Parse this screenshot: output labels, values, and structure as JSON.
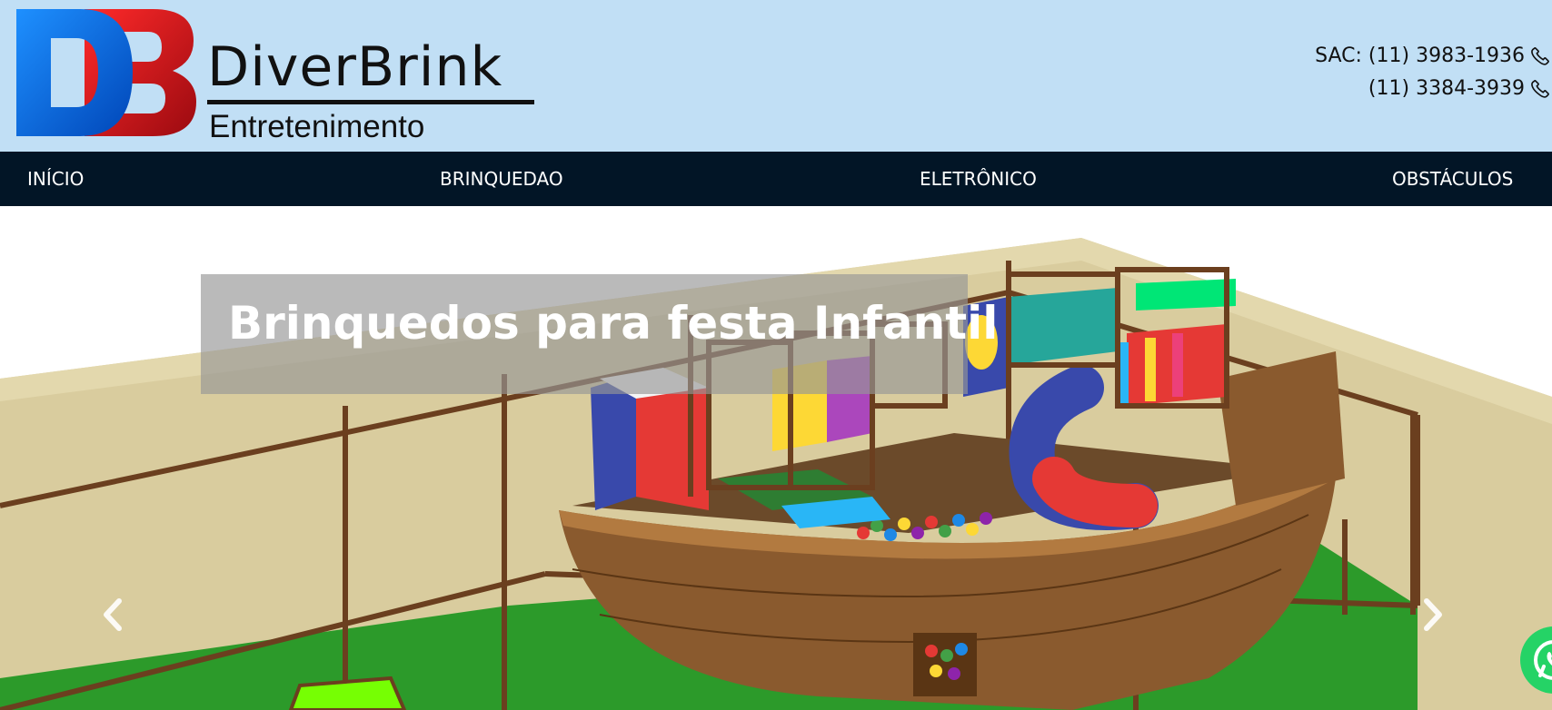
{
  "header": {
    "brand_name": "DiverBrink",
    "brand_sub": "Entretenimento",
    "logo_letters": "DB",
    "contacts": [
      {
        "label": "SAC: (11) 3983-1936",
        "icon": "phone-icon"
      },
      {
        "label": "(11) 3384-3939",
        "icon": "phone-icon"
      }
    ]
  },
  "nav": {
    "items": [
      "INÍCIO",
      "BRINQUEDAO",
      "ELETRÔNICO",
      "OBSTÁCULOS"
    ]
  },
  "hero": {
    "caption": "Brinquedos para festa Infantil",
    "prev_icon": "chevron-left-icon",
    "next_icon": "chevron-right-icon"
  },
  "floating": {
    "whatsapp_icon": "whatsapp-icon"
  },
  "colors": {
    "header_bg": "#c1dff5",
    "nav_bg": "#021526",
    "logo_blue": "#0a6fe8",
    "logo_red": "#d4141c",
    "whatsapp_green": "#25d366"
  }
}
